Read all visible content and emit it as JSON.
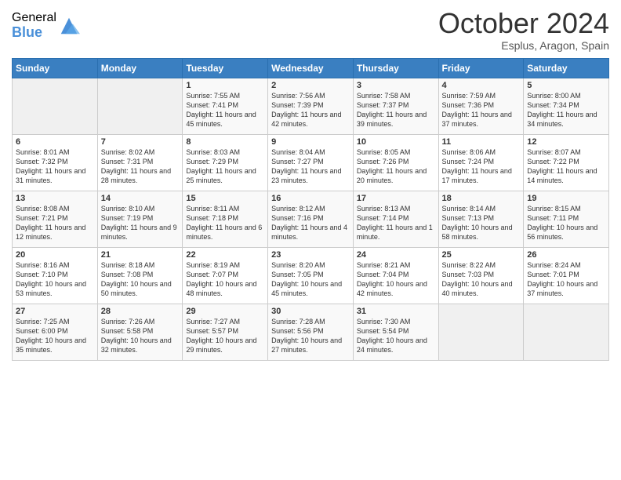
{
  "logo": {
    "general": "General",
    "blue": "Blue"
  },
  "title": "October 2024",
  "subtitle": "Esplus, Aragon, Spain",
  "days_of_week": [
    "Sunday",
    "Monday",
    "Tuesday",
    "Wednesday",
    "Thursday",
    "Friday",
    "Saturday"
  ],
  "weeks": [
    [
      {
        "day": "",
        "info": ""
      },
      {
        "day": "",
        "info": ""
      },
      {
        "day": "1",
        "sunrise": "Sunrise: 7:55 AM",
        "sunset": "Sunset: 7:41 PM",
        "daylight": "Daylight: 11 hours and 45 minutes."
      },
      {
        "day": "2",
        "sunrise": "Sunrise: 7:56 AM",
        "sunset": "Sunset: 7:39 PM",
        "daylight": "Daylight: 11 hours and 42 minutes."
      },
      {
        "day": "3",
        "sunrise": "Sunrise: 7:58 AM",
        "sunset": "Sunset: 7:37 PM",
        "daylight": "Daylight: 11 hours and 39 minutes."
      },
      {
        "day": "4",
        "sunrise": "Sunrise: 7:59 AM",
        "sunset": "Sunset: 7:36 PM",
        "daylight": "Daylight: 11 hours and 37 minutes."
      },
      {
        "day": "5",
        "sunrise": "Sunrise: 8:00 AM",
        "sunset": "Sunset: 7:34 PM",
        "daylight": "Daylight: 11 hours and 34 minutes."
      }
    ],
    [
      {
        "day": "6",
        "sunrise": "Sunrise: 8:01 AM",
        "sunset": "Sunset: 7:32 PM",
        "daylight": "Daylight: 11 hours and 31 minutes."
      },
      {
        "day": "7",
        "sunrise": "Sunrise: 8:02 AM",
        "sunset": "Sunset: 7:31 PM",
        "daylight": "Daylight: 11 hours and 28 minutes."
      },
      {
        "day": "8",
        "sunrise": "Sunrise: 8:03 AM",
        "sunset": "Sunset: 7:29 PM",
        "daylight": "Daylight: 11 hours and 25 minutes."
      },
      {
        "day": "9",
        "sunrise": "Sunrise: 8:04 AM",
        "sunset": "Sunset: 7:27 PM",
        "daylight": "Daylight: 11 hours and 23 minutes."
      },
      {
        "day": "10",
        "sunrise": "Sunrise: 8:05 AM",
        "sunset": "Sunset: 7:26 PM",
        "daylight": "Daylight: 11 hours and 20 minutes."
      },
      {
        "day": "11",
        "sunrise": "Sunrise: 8:06 AM",
        "sunset": "Sunset: 7:24 PM",
        "daylight": "Daylight: 11 hours and 17 minutes."
      },
      {
        "day": "12",
        "sunrise": "Sunrise: 8:07 AM",
        "sunset": "Sunset: 7:22 PM",
        "daylight": "Daylight: 11 hours and 14 minutes."
      }
    ],
    [
      {
        "day": "13",
        "sunrise": "Sunrise: 8:08 AM",
        "sunset": "Sunset: 7:21 PM",
        "daylight": "Daylight: 11 hours and 12 minutes."
      },
      {
        "day": "14",
        "sunrise": "Sunrise: 8:10 AM",
        "sunset": "Sunset: 7:19 PM",
        "daylight": "Daylight: 11 hours and 9 minutes."
      },
      {
        "day": "15",
        "sunrise": "Sunrise: 8:11 AM",
        "sunset": "Sunset: 7:18 PM",
        "daylight": "Daylight: 11 hours and 6 minutes."
      },
      {
        "day": "16",
        "sunrise": "Sunrise: 8:12 AM",
        "sunset": "Sunset: 7:16 PM",
        "daylight": "Daylight: 11 hours and 4 minutes."
      },
      {
        "day": "17",
        "sunrise": "Sunrise: 8:13 AM",
        "sunset": "Sunset: 7:14 PM",
        "daylight": "Daylight: 11 hours and 1 minute."
      },
      {
        "day": "18",
        "sunrise": "Sunrise: 8:14 AM",
        "sunset": "Sunset: 7:13 PM",
        "daylight": "Daylight: 10 hours and 58 minutes."
      },
      {
        "day": "19",
        "sunrise": "Sunrise: 8:15 AM",
        "sunset": "Sunset: 7:11 PM",
        "daylight": "Daylight: 10 hours and 56 minutes."
      }
    ],
    [
      {
        "day": "20",
        "sunrise": "Sunrise: 8:16 AM",
        "sunset": "Sunset: 7:10 PM",
        "daylight": "Daylight: 10 hours and 53 minutes."
      },
      {
        "day": "21",
        "sunrise": "Sunrise: 8:18 AM",
        "sunset": "Sunset: 7:08 PM",
        "daylight": "Daylight: 10 hours and 50 minutes."
      },
      {
        "day": "22",
        "sunrise": "Sunrise: 8:19 AM",
        "sunset": "Sunset: 7:07 PM",
        "daylight": "Daylight: 10 hours and 48 minutes."
      },
      {
        "day": "23",
        "sunrise": "Sunrise: 8:20 AM",
        "sunset": "Sunset: 7:05 PM",
        "daylight": "Daylight: 10 hours and 45 minutes."
      },
      {
        "day": "24",
        "sunrise": "Sunrise: 8:21 AM",
        "sunset": "Sunset: 7:04 PM",
        "daylight": "Daylight: 10 hours and 42 minutes."
      },
      {
        "day": "25",
        "sunrise": "Sunrise: 8:22 AM",
        "sunset": "Sunset: 7:03 PM",
        "daylight": "Daylight: 10 hours and 40 minutes."
      },
      {
        "day": "26",
        "sunrise": "Sunrise: 8:24 AM",
        "sunset": "Sunset: 7:01 PM",
        "daylight": "Daylight: 10 hours and 37 minutes."
      }
    ],
    [
      {
        "day": "27",
        "sunrise": "Sunrise: 7:25 AM",
        "sunset": "Sunset: 6:00 PM",
        "daylight": "Daylight: 10 hours and 35 minutes."
      },
      {
        "day": "28",
        "sunrise": "Sunrise: 7:26 AM",
        "sunset": "Sunset: 5:58 PM",
        "daylight": "Daylight: 10 hours and 32 minutes."
      },
      {
        "day": "29",
        "sunrise": "Sunrise: 7:27 AM",
        "sunset": "Sunset: 5:57 PM",
        "daylight": "Daylight: 10 hours and 29 minutes."
      },
      {
        "day": "30",
        "sunrise": "Sunrise: 7:28 AM",
        "sunset": "Sunset: 5:56 PM",
        "daylight": "Daylight: 10 hours and 27 minutes."
      },
      {
        "day": "31",
        "sunrise": "Sunrise: 7:30 AM",
        "sunset": "Sunset: 5:54 PM",
        "daylight": "Daylight: 10 hours and 24 minutes."
      },
      {
        "day": "",
        "info": ""
      },
      {
        "day": "",
        "info": ""
      }
    ]
  ]
}
